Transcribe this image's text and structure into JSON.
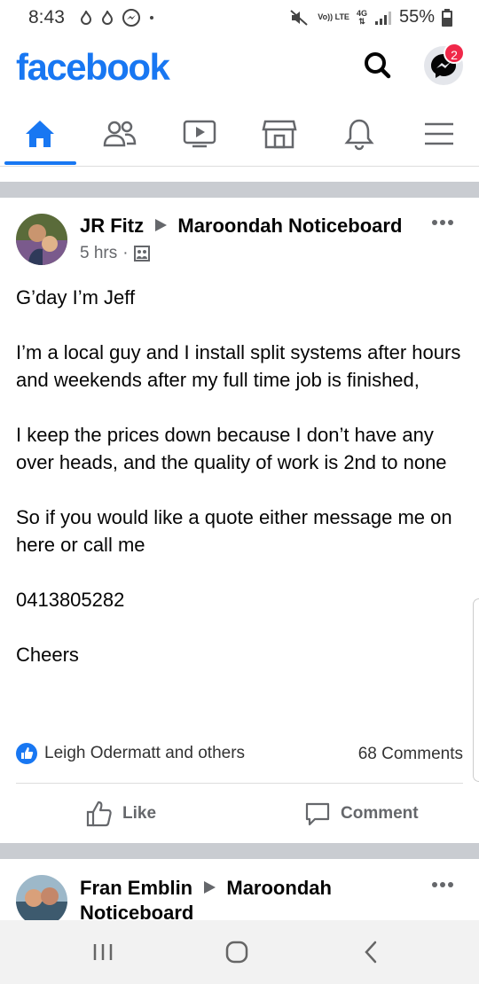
{
  "status_bar": {
    "time": "8:43",
    "network_top": "Vo)) LTE",
    "network_type": "4G",
    "battery": "55%"
  },
  "header": {
    "logo": "facebook",
    "messenger_badge": "2",
    "icons": [
      "search-icon",
      "messenger-icon"
    ]
  },
  "tabs": [
    {
      "name": "home",
      "icon": "home-icon",
      "active": true
    },
    {
      "name": "friends",
      "icon": "friends-icon",
      "active": false
    },
    {
      "name": "watch",
      "icon": "video-icon",
      "active": false
    },
    {
      "name": "marketplace",
      "icon": "store-icon",
      "active": false
    },
    {
      "name": "notifications",
      "icon": "bell-icon",
      "active": false
    },
    {
      "name": "menu",
      "icon": "hamburger-icon",
      "active": false
    }
  ],
  "post1": {
    "author": "JR Fitz",
    "group": "Maroondah Noticeboard",
    "time": "5 hrs",
    "body": [
      "G’day I’m Jeff",
      "I’m a local guy and I install split systems after hours and weekends after my full time job is finished,",
      "I keep the prices down because I don’t have any over heads, and the quality of work is 2nd to none",
      "So if you would like a quote either message me on here or call me",
      "0413805282",
      "Cheers"
    ],
    "reactions_text": "Leigh Odermatt and others",
    "comments_text": "68 Comments",
    "like_label": "Like",
    "comment_label": "Comment"
  },
  "post2": {
    "author": "Fran Emblin",
    "group": "Maroondah",
    "group_line2": "Noticeboard"
  },
  "colors": {
    "brand": "#1877f2",
    "badge": "#f02849",
    "separator": "#c9ccd1"
  }
}
